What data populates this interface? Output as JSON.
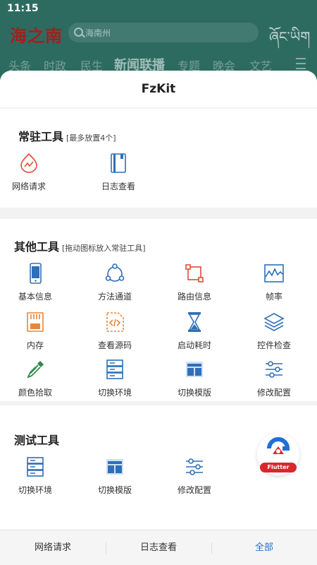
{
  "status_bar": {
    "time": "11:15"
  },
  "app": {
    "logo": "海之南",
    "search_placeholder": "海南州",
    "tibetan_text": "ཞོང་ཡིག",
    "nav_tabs": [
      "头条",
      "时政",
      "民生",
      "新闻联播",
      "专题",
      "晚会",
      "文艺"
    ],
    "active_tab": "新闻联播"
  },
  "sheet": {
    "title": "FzKit",
    "resident_tools": {
      "title": "常驻工具",
      "hint": "[最多放置4个]",
      "items": [
        {
          "label": "网络请求",
          "icon": "network-request-icon"
        },
        {
          "label": "日志查看",
          "icon": "log-view-icon"
        }
      ]
    },
    "other_tools": {
      "title": "其他工具",
      "hint": "[拖动图标放入常驻工具]",
      "items": [
        {
          "label": "基本信息",
          "icon": "phone-info-icon"
        },
        {
          "label": "方法通道",
          "icon": "channel-icon"
        },
        {
          "label": "路由信息",
          "icon": "route-icon"
        },
        {
          "label": "帧率",
          "icon": "fps-icon"
        },
        {
          "label": "内存",
          "icon": "memory-card-icon"
        },
        {
          "label": "查看源码",
          "icon": "source-code-icon"
        },
        {
          "label": "启动耗时",
          "icon": "hourglass-icon"
        },
        {
          "label": "控件检查",
          "icon": "layers-icon"
        },
        {
          "label": "颜色拾取",
          "icon": "color-picker-icon"
        },
        {
          "label": "切换环境",
          "icon": "server-icon"
        },
        {
          "label": "切换模版",
          "icon": "template-icon"
        },
        {
          "label": "修改配置",
          "icon": "sliders-icon"
        }
      ]
    },
    "test_tools": {
      "title": "测试工具",
      "items": [
        {
          "label": "切换环境",
          "icon": "server-icon"
        },
        {
          "label": "切换模版",
          "icon": "template-icon"
        },
        {
          "label": "修改配置",
          "icon": "sliders-icon"
        }
      ]
    },
    "flutter_badge": "Flutter",
    "bottom_tabs": [
      {
        "label": "网络请求"
      },
      {
        "label": "日志查看"
      },
      {
        "label": "全部",
        "active": true
      }
    ]
  },
  "colors": {
    "accent": "#1f6fd6",
    "header_bg": "#2d6b61",
    "logo": "#a31f1f",
    "flutter_red": "#d7282f"
  }
}
